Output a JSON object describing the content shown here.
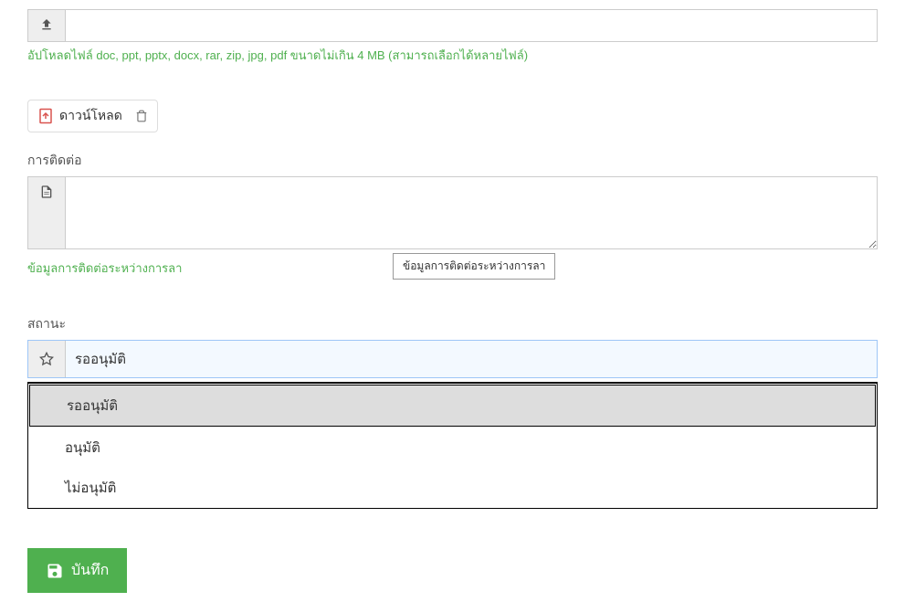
{
  "upload": {
    "help_text": "อัปโหลดไฟล์ doc, ppt, pptx, docx, rar, zip, jpg, pdf ขนาดไม่เกิน 4 MB (สามารถเลือกได้หลายไฟล์)"
  },
  "download": {
    "label": "ดาวน์โหลด"
  },
  "contact": {
    "label": "การติดต่อ",
    "help_text": "ข้อมูลการติดต่อระหว่างการลา",
    "tooltip": "ข้อมูลการติดต่อระหว่างการลา"
  },
  "status": {
    "label": "สถานะ",
    "value": "รออนุมัติ",
    "options": [
      "รออนุมัติ",
      "อนุมัติ",
      "ไม่อนุมัติ"
    ]
  },
  "save_button": {
    "label": "บันทึก"
  }
}
